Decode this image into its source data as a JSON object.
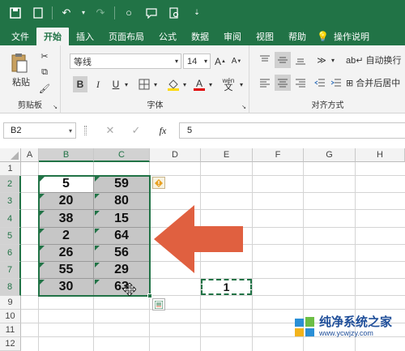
{
  "tabs": [
    "文件",
    "开始",
    "插入",
    "页面布局",
    "公式",
    "数据",
    "审阅",
    "视图",
    "帮助",
    "操作说明"
  ],
  "active_tab": "开始",
  "ribbon": {
    "paste_label": "粘贴",
    "clipboard_label": "剪贴板",
    "font_name": "等线",
    "font_size": "14",
    "bold": "B",
    "italic": "I",
    "underline": "U",
    "font_label": "字体",
    "wrap_text": "自动换行",
    "merge_center": "合并后居中",
    "align_label": "对齐方式",
    "wen": "wén"
  },
  "formula_bar": {
    "name_box": "B2",
    "fx": "fx",
    "formula": "5"
  },
  "columns": [
    "A",
    "B",
    "C",
    "D",
    "E",
    "F",
    "G",
    "H"
  ],
  "rows": [
    "1",
    "2",
    "3",
    "4",
    "5",
    "6",
    "7",
    "8",
    "9",
    "10",
    "11",
    "12"
  ],
  "col_b_values": [
    "5",
    "20",
    "38",
    "2",
    "26",
    "55",
    "30"
  ],
  "col_c_values": [
    "59",
    "80",
    "15",
    "64",
    "56",
    "29",
    "63"
  ],
  "e8_value": "1",
  "watermark": {
    "title": "纯净系统之家",
    "url": "www.ycwjzy.com"
  },
  "colors": {
    "excel_green": "#217346",
    "arrow": "#e06040",
    "selection_fill": "#c6c6c6"
  }
}
